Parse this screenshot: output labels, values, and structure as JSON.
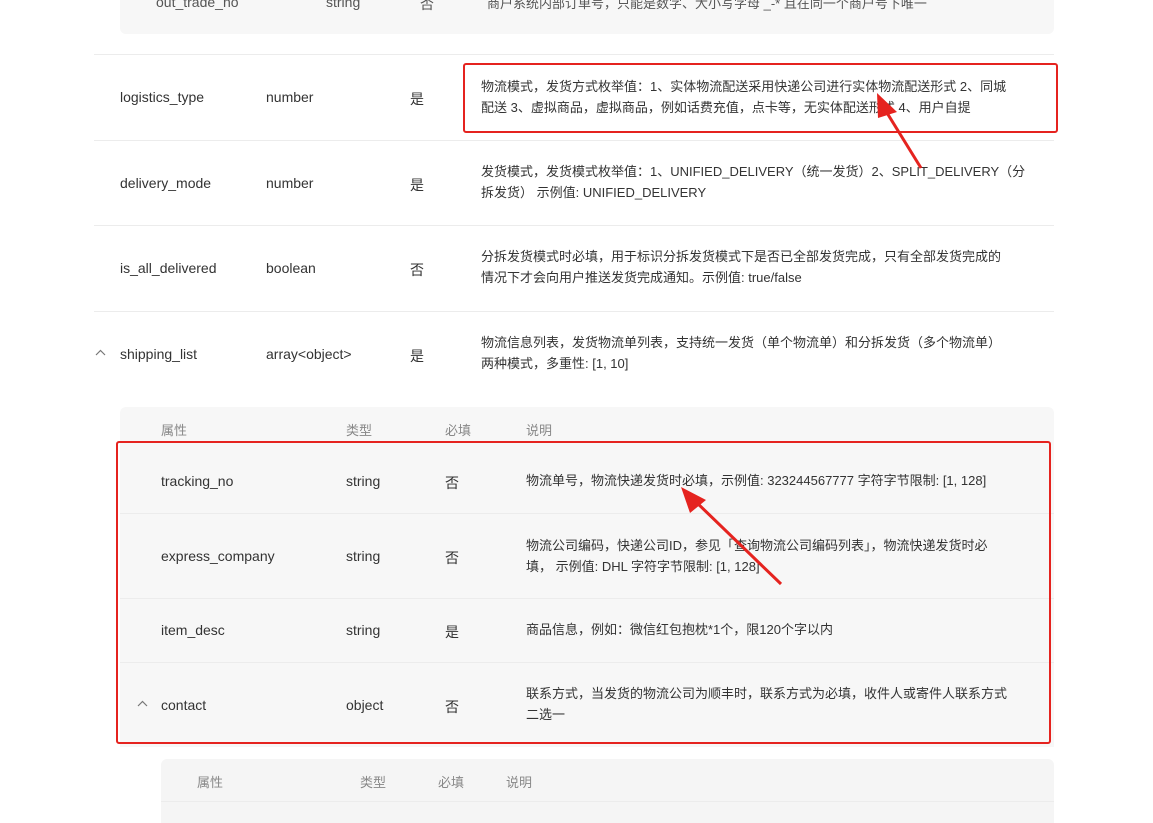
{
  "prev_row": {
    "name": "out_trade_no",
    "type": "string",
    "required": "否",
    "desc": "商户系统内部订单号，只能是数字、大小写字母 _-* 且在同一个商户号下唯一"
  },
  "rows": [
    {
      "name": "logistics_type",
      "type": "number",
      "required": "是",
      "desc_line1": "物流模式，发货方式枚举值：1、实体物流配送采用快递公司进行实体物流配送形式 2、同城",
      "desc_line2": "配送 3、虚拟商品，虚拟商品，例如话费充值，点卡等，无实体配送形式 4、用户自提"
    },
    {
      "name": "delivery_mode",
      "type": "number",
      "required": "是",
      "desc_line1": "发货模式，发货模式枚举值：1、UNIFIED_DELIVERY（统一发货）2、SPLIT_DELIVERY（分",
      "desc_line2": "拆发货） 示例值: UNIFIED_DELIVERY"
    },
    {
      "name": "is_all_delivered",
      "type": "boolean",
      "required": "否",
      "desc_line1": "分拆发货模式时必填，用于标识分拆发货模式下是否已全部发货完成，只有全部发货完成的",
      "desc_line2": "情况下才会向用户推送发货完成通知。示例值: true/false"
    },
    {
      "name": "shipping_list",
      "type": "array<object>",
      "required": "是",
      "desc_line1": "物流信息列表，发货物流单列表，支持统一发货（单个物流单）和分拆发货（多个物流单）",
      "desc_line2": "两种模式，多重性: [1, 10]"
    }
  ],
  "nested_header": {
    "col_attr": "属性",
    "col_type": "类型",
    "col_required": "必填",
    "col_desc": "说明"
  },
  "nested_rows": [
    {
      "name": "tracking_no",
      "type": "string",
      "required": "否",
      "desc_line1": "物流单号，物流快递发货时必填，示例值: 323244567777 字符字节限制: [1, 128]",
      "desc_line2": ""
    },
    {
      "name": "express_company",
      "type": "string",
      "required": "否",
      "desc_line1": "物流公司编码，快递公司ID，参见「查询物流公司编码列表」，物流快递发货时必",
      "desc_line2": "填， 示例值: DHL 字符字节限制: [1, 128]"
    },
    {
      "name": "item_desc",
      "type": "string",
      "required": "是",
      "desc_line1": "商品信息，例如：微信红包抱枕*1个，限120个字以内",
      "desc_line2": ""
    },
    {
      "name": "contact",
      "type": "object",
      "required": "否",
      "desc_line1": "联系方式，当发货的物流公司为顺丰时，联系方式为必填，收件人或寄件人联系方式",
      "desc_line2": "二选一"
    }
  ],
  "nested2_header": {
    "col_attr": "属性",
    "col_type": "类型",
    "col_required": "必填",
    "col_desc": "说明"
  },
  "icons": {
    "collapse": "chevron-up-icon",
    "annotation": "red-arrow-icon"
  },
  "colors": {
    "annotation_red": "#e5231f",
    "panel_bg": "#f7f7f7",
    "divider": "#ececec"
  }
}
